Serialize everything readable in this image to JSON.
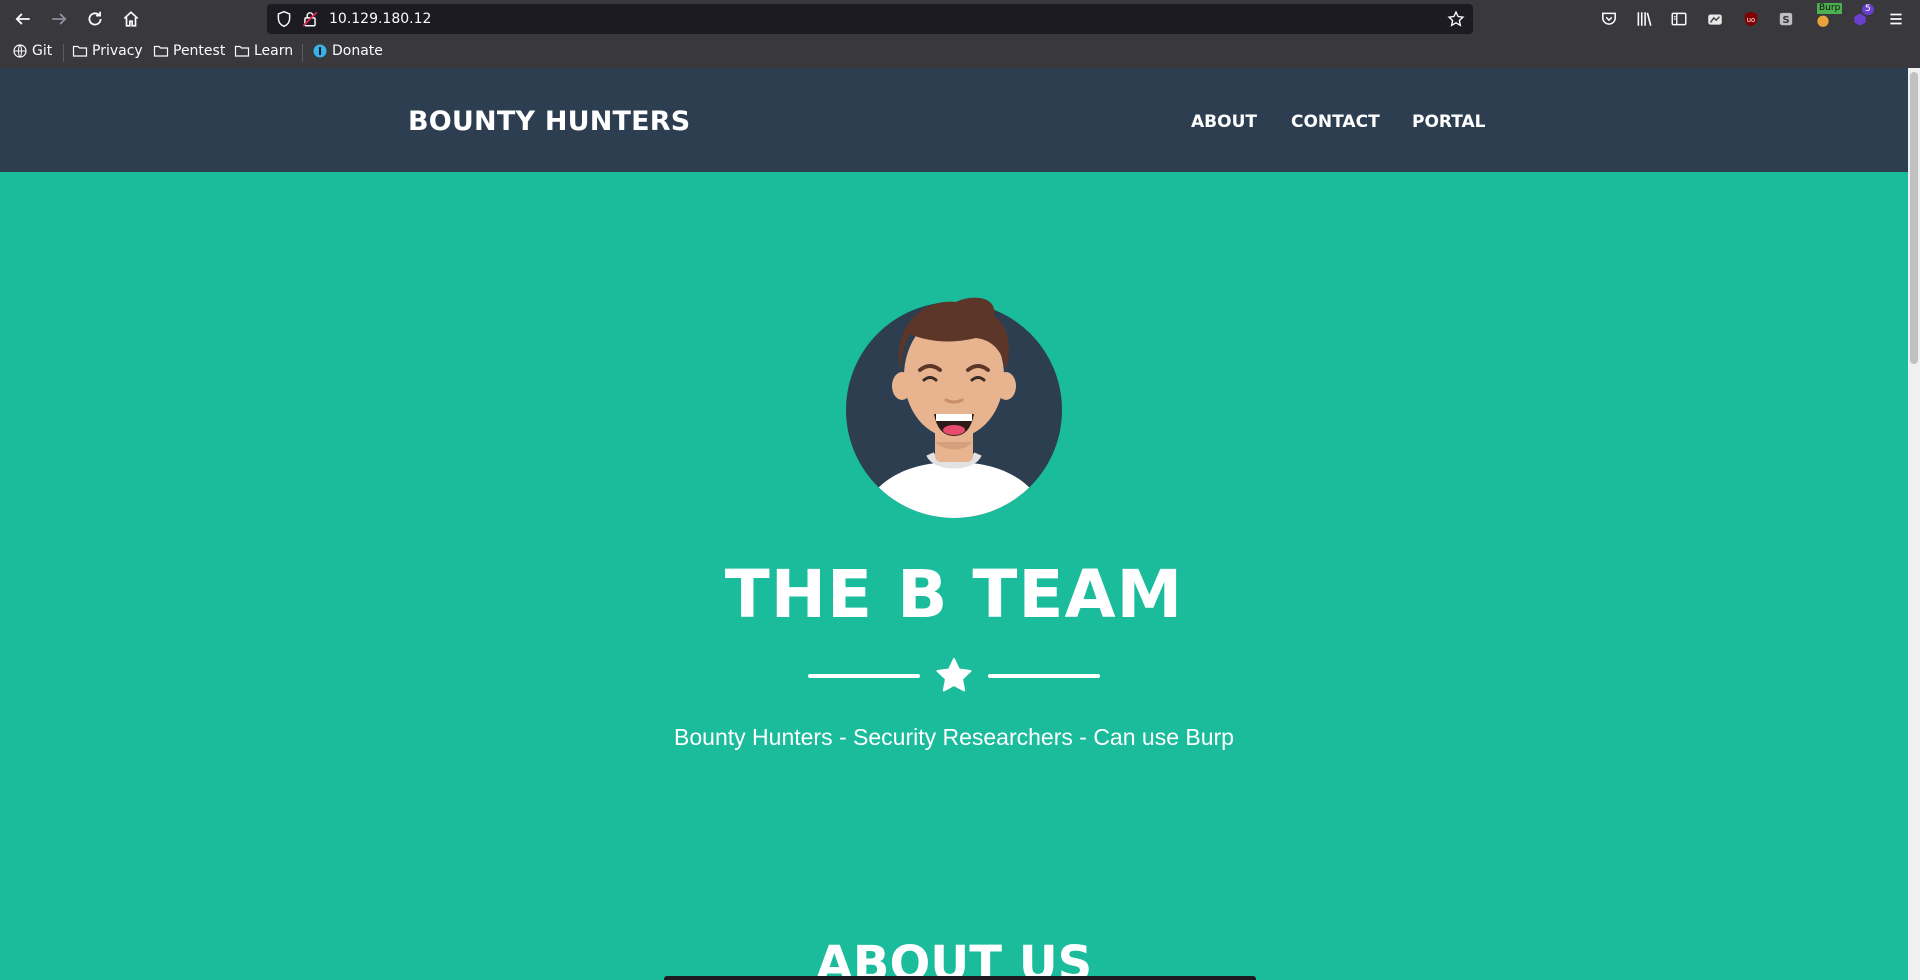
{
  "browser": {
    "url": "10.129.180.12",
    "extension_badge_count": "5",
    "extension_label": "Burp",
    "bookmarks": [
      {
        "label": "Git",
        "icon": "globe-icon"
      },
      {
        "label": "Privacy",
        "icon": "folder-icon"
      },
      {
        "label": "Pentest",
        "icon": "folder-icon"
      },
      {
        "label": "Learn",
        "icon": "folder-icon"
      },
      {
        "label": "Donate",
        "icon": "donate-icon"
      }
    ]
  },
  "site": {
    "brand": "BOUNTY HUNTERS",
    "nav": [
      {
        "label": "ABOUT"
      },
      {
        "label": "CONTACT"
      },
      {
        "label": "PORTAL"
      }
    ],
    "masthead": {
      "title": "THE B TEAM",
      "subtitle": "Bounty Hunters - Security Researchers - Can use Burp"
    },
    "about_title": "ABOUT US"
  },
  "colors": {
    "primary": "#1abc9c",
    "navbar": "#2c3e50",
    "text": "#ffffff",
    "chrome": "#38383d"
  }
}
